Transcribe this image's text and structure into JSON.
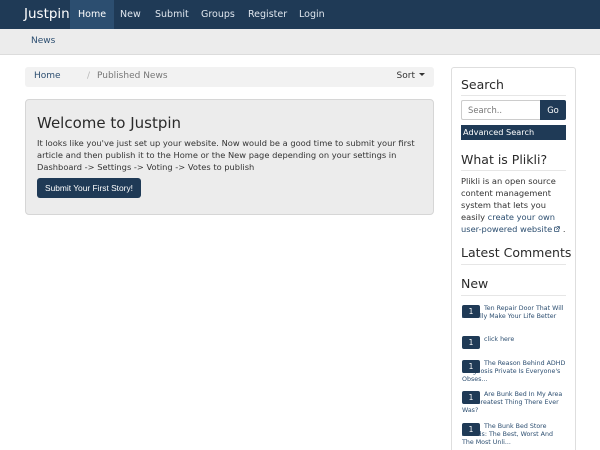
{
  "navbar": {
    "brand": "Justpin",
    "items": [
      {
        "label": "Home",
        "active": true
      },
      {
        "label": "New",
        "active": false
      },
      {
        "label": "Submit",
        "active": false
      },
      {
        "label": "Groups",
        "active": false
      },
      {
        "label": "Register",
        "active": false
      },
      {
        "label": "Login",
        "active": false
      }
    ]
  },
  "subnav": {
    "items": [
      {
        "label": "News"
      }
    ]
  },
  "breadcrumb": {
    "home": "Home",
    "separator": "/",
    "current": "Published News",
    "sort_label": "Sort"
  },
  "welcome": {
    "title": "Welcome to Justpin",
    "text": "It looks like you've just set up your website. Now would be a good time to submit your first article and then publish it to the Home or the New page depending on your settings in Dashboard -> Settings -> Voting -> Votes to publish",
    "button": "Submit Your First Story!"
  },
  "sidebar": {
    "search": {
      "heading": "Search",
      "placeholder": "Search..",
      "go_label": "Go",
      "advanced_label": "Advanced Search"
    },
    "about": {
      "heading": "What is Plikli?",
      "text": "Plikli is an open source content management system that lets you easily ",
      "link": "create your own user-powered website",
      "suffix": " ."
    },
    "latest_comments": {
      "heading": "Latest Comments"
    },
    "new": {
      "heading": "New",
      "items": [
        {
          "votes": "1",
          "title": "Ten Repair Door That Will Actually Make Your Life Better"
        },
        {
          "votes": "1",
          "title": "click here"
        },
        {
          "votes": "1",
          "title": "The Reason Behind ADHD Diagnosis Private Is Everyone's Obses..."
        },
        {
          "votes": "1",
          "title": "Are Bunk Bed In My Area The Greatest Thing There Ever Was?"
        },
        {
          "votes": "1",
          "title": "The Bunk Bed Store Awards: The Best, Worst And The Most Unli..."
        }
      ]
    }
  },
  "colors": {
    "primary": "#1f3a56",
    "navbar_active": "#2c4e70",
    "subnav_bg": "#ececec",
    "panel_bg": "#ececec"
  }
}
